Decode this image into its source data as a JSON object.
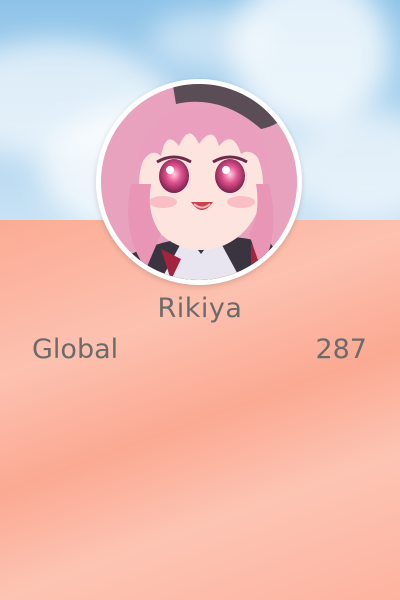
{
  "profile": {
    "username": "Rikiya",
    "avatar_icon": "anime-avatar",
    "ranking": {
      "scope_label": "Global",
      "value": "287"
    }
  },
  "colors": {
    "text": "#6b6b6b",
    "sky": "#8ec3e8",
    "gradient_light": "#fdc1b0",
    "gradient_dark": "#fba992",
    "avatar_ring": "#ffffff"
  }
}
